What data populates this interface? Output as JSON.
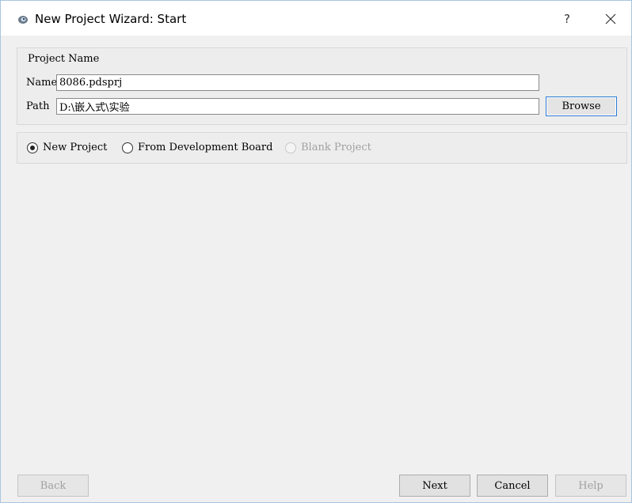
{
  "window": {
    "title": "New Project Wizard: Start",
    "help_glyph": "?",
    "close_icon": "close-icon",
    "app_icon": "proteus-app-icon"
  },
  "project_name": {
    "group_title": "Project Name",
    "name_label": "Name",
    "name_value": "8086.pdsprj",
    "path_label": "Path",
    "path_value": "D:\\嵌入式\\实验",
    "browse_label": "Browse"
  },
  "project_type": {
    "options": [
      {
        "label": "New Project",
        "selected": true,
        "enabled": true
      },
      {
        "label": "From Development Board",
        "selected": false,
        "enabled": true
      },
      {
        "label": "Blank Project",
        "selected": false,
        "enabled": false
      }
    ]
  },
  "footer": {
    "back_label": "Back",
    "next_label": "Next",
    "cancel_label": "Cancel",
    "help_label": "Help"
  },
  "colors": {
    "accent_border": "#2a7ad4",
    "disabled_text": "#a0a0a0",
    "window_bg": "#f0f0f0"
  }
}
